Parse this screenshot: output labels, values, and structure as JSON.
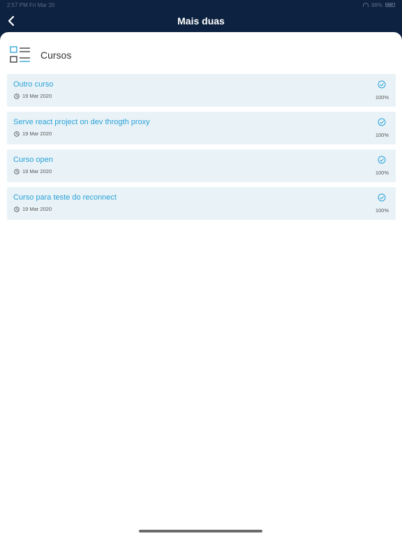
{
  "status_bar": {
    "time": "2:57 PM",
    "date": "Fri Mar 20",
    "battery": "98%"
  },
  "nav": {
    "title": "Mais duas",
    "back_icon": "chevron-left-icon"
  },
  "section": {
    "title": "Cursos",
    "icon": "list-checklist-icon"
  },
  "colors": {
    "header_bg": "#0d2240",
    "card_bg": "#e9f3f7",
    "accent": "#2aa0d8"
  },
  "courses": [
    {
      "title": "Outro curso",
      "date": "19 Mar 2020",
      "progress": "100%"
    },
    {
      "title": "Serve react project on dev throgth proxy",
      "date": "19 Mar 2020",
      "progress": "100%"
    },
    {
      "title": "Curso open",
      "date": "19 Mar 2020",
      "progress": "100%"
    },
    {
      "title": "Curso para teste do reconnect",
      "date": "19 Mar 2020",
      "progress": "100%"
    }
  ]
}
